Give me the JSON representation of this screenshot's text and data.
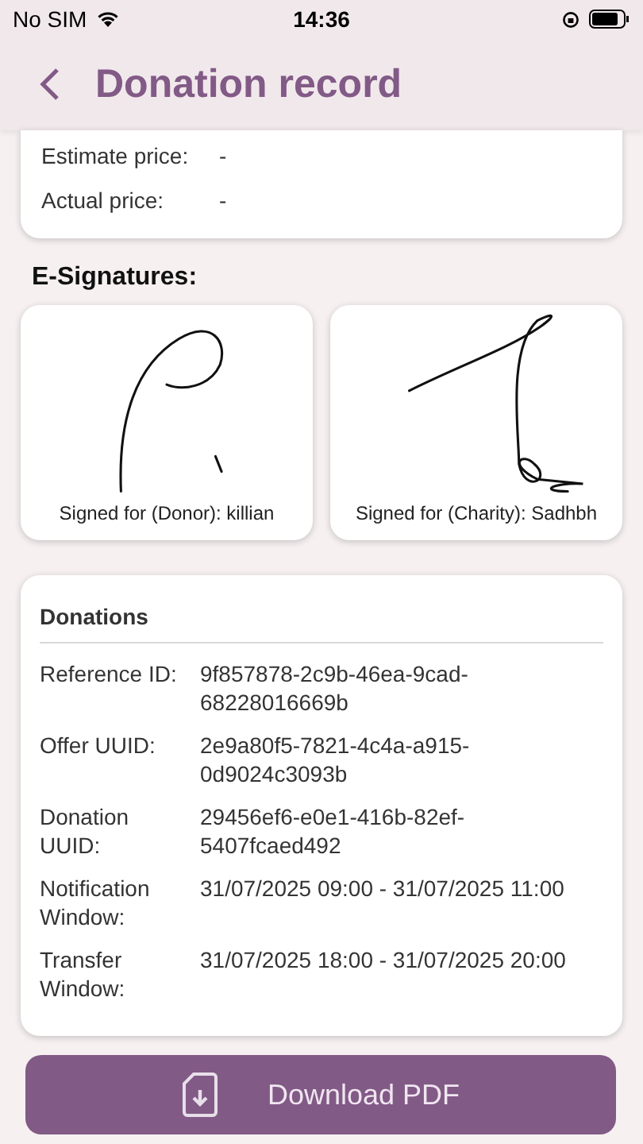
{
  "status_bar": {
    "carrier": "No SIM",
    "time": "14:36"
  },
  "header": {
    "title": "Donation record"
  },
  "price_card": {
    "rows": [
      {
        "label": "Estimate price:",
        "value": "-"
      },
      {
        "label": "Actual price:",
        "value": "-"
      }
    ]
  },
  "signatures": {
    "title": "E-Signatures:",
    "items": [
      {
        "caption": "Signed for (Donor): killian",
        "kind": "donor"
      },
      {
        "caption": "Signed for (Charity): Sadhbh",
        "kind": "charity"
      }
    ]
  },
  "donations": {
    "title": "Donations",
    "rows": [
      {
        "label": "Reference ID:",
        "value": "9f857878-2c9b-46ea-9cad-68228016669b"
      },
      {
        "label": "Offer UUID:",
        "value": "2e9a80f5-7821-4c4a-a915-0d9024c3093b"
      },
      {
        "label": "Donation UUID:",
        "value": "29456ef6-e0e1-416b-82ef-5407fcaed492"
      },
      {
        "label": "Notification Window:",
        "value": "31/07/2025 09:00 - 31/07/2025 11:00"
      },
      {
        "label": "Transfer Window:",
        "value": "31/07/2025 18:00 - 31/07/2025 20:00"
      }
    ]
  },
  "button": {
    "label": "Download PDF"
  }
}
